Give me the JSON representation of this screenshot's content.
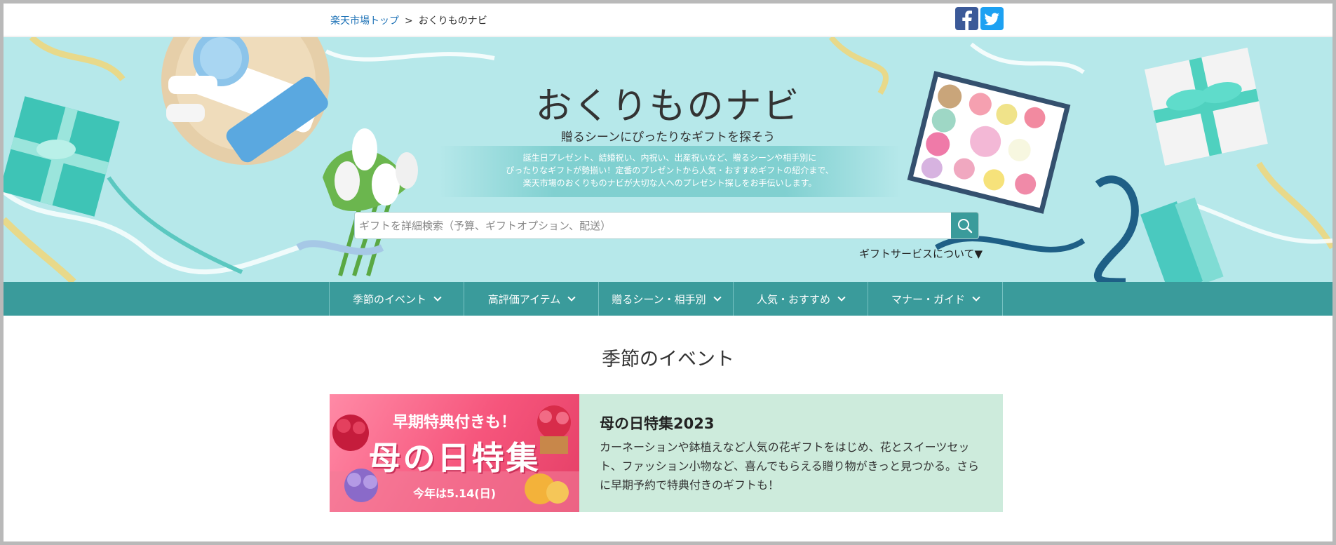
{
  "breadcrumb": {
    "home": "楽天市場トップ",
    "separator": ">",
    "current": "おくりものナビ"
  },
  "social": {
    "facebook_icon": "facebook-icon",
    "twitter_icon": "twitter-icon"
  },
  "hero": {
    "title": "おくりものナビ",
    "subtitle": "贈るシーンにぴったりなギフトを探そう",
    "desc_line1": "誕生日プレゼント、結婚祝い、内祝い、出産祝いなど、贈るシーンや相手別に",
    "desc_line2": "ぴったりなギフトが勢揃い！定番のプレゼントから人気・おすすめギフトの紹介まで、",
    "desc_line3": "楽天市場のおくりものナビが大切な人へのプレゼント探しをお手伝いします。"
  },
  "search": {
    "placeholder": "ギフトを詳細検索（予算、ギフトオプション、配送）",
    "icon": "search-icon"
  },
  "gift_service_link": "ギフトサービスについて▼",
  "nav": {
    "items": [
      {
        "label": "季節のイベント"
      },
      {
        "label": "高評価アイテム"
      },
      {
        "label": "贈るシーン・相手別"
      },
      {
        "label": "人気・おすすめ"
      },
      {
        "label": "マナー・ガイド"
      }
    ]
  },
  "section": {
    "title": "季節のイベント"
  },
  "feature": {
    "banner_line1": "早期特典付きも！",
    "banner_line2": "母の日特集",
    "banner_line3": "今年は5.14(日)",
    "title": "母の日特集2023",
    "description": "カーネーションや鉢植えなど人気の花ギフトをはじめ、花とスイーツセット、ファッション小物など、喜んでもらえる贈り物がきっと見つかる。さらに早期予約で特典付きのギフトも！"
  },
  "colors": {
    "hero_bg": "#b6e8ea",
    "nav_bg": "#3a9b9b",
    "feature_bg": "#cdebdc",
    "banner_pink": "#f6557c",
    "link_blue": "#1f73b7"
  }
}
